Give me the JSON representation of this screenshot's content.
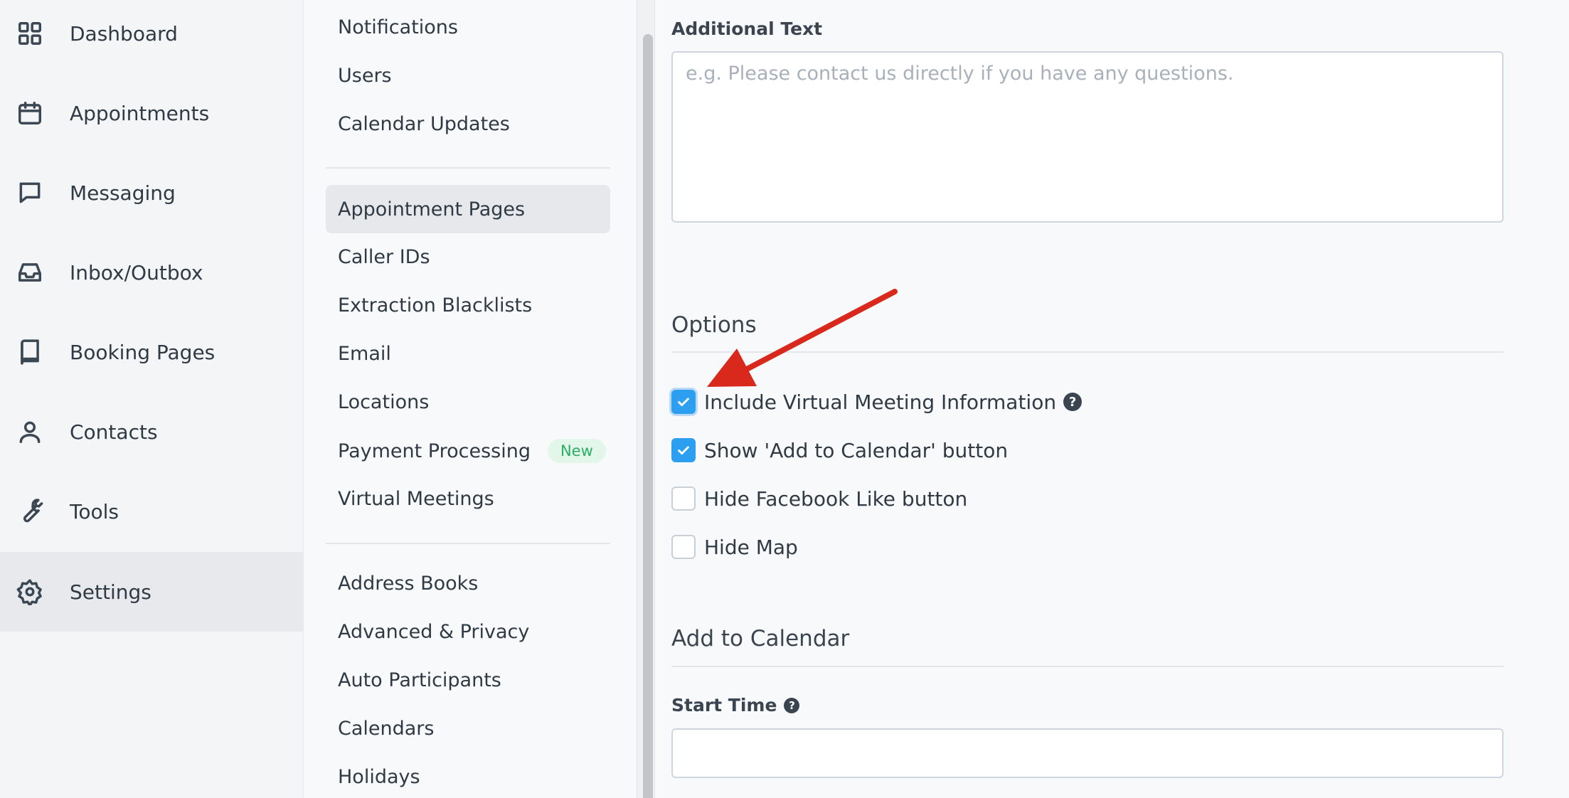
{
  "primary_nav": [
    {
      "label": "Dashboard",
      "icon": "grid-icon",
      "active": false
    },
    {
      "label": "Appointments",
      "icon": "calendar-icon",
      "active": false
    },
    {
      "label": "Messaging",
      "icon": "message-icon",
      "active": false
    },
    {
      "label": "Inbox/Outbox",
      "icon": "inbox-icon",
      "active": false
    },
    {
      "label": "Booking Pages",
      "icon": "book-icon",
      "active": false
    },
    {
      "label": "Contacts",
      "icon": "person-icon",
      "active": false
    },
    {
      "label": "Tools",
      "icon": "wrench-icon",
      "active": false
    },
    {
      "label": "Settings",
      "icon": "gear-icon",
      "active": true
    }
  ],
  "settings_menu": {
    "group1": [
      "Notifications",
      "Users",
      "Calendar Updates"
    ],
    "group2": [
      {
        "label": "Appointment Pages",
        "active": true
      },
      {
        "label": "Caller IDs"
      },
      {
        "label": "Extraction Blacklists"
      },
      {
        "label": "Email"
      },
      {
        "label": "Locations"
      },
      {
        "label": "Payment Processing",
        "badge": "New"
      },
      {
        "label": "Virtual Meetings"
      }
    ],
    "group3": [
      "Address Books",
      "Advanced & Privacy",
      "Auto Participants",
      "Calendars",
      "Holidays"
    ]
  },
  "main": {
    "additional_text": {
      "label": "Additional Text",
      "placeholder": "e.g. Please contact us directly if you have any questions.",
      "value": ""
    },
    "options": {
      "title": "Options",
      "items": [
        {
          "label": "Include Virtual Meeting Information",
          "checked": true,
          "help": true
        },
        {
          "label": "Show 'Add to Calendar' button",
          "checked": true,
          "help": false
        },
        {
          "label": "Hide Facebook Like button",
          "checked": false,
          "help": false
        },
        {
          "label": "Hide Map",
          "checked": false,
          "help": false
        }
      ]
    },
    "add_to_calendar": {
      "title": "Add to Calendar",
      "start_time_label": "Start Time",
      "start_time_value": ""
    },
    "help_glyph": "?"
  },
  "colors": {
    "accent": "#2d9ff0",
    "badge_bg": "#e3f6ea",
    "badge_text": "#2aae63",
    "annotation_arrow": "#d8291c"
  }
}
